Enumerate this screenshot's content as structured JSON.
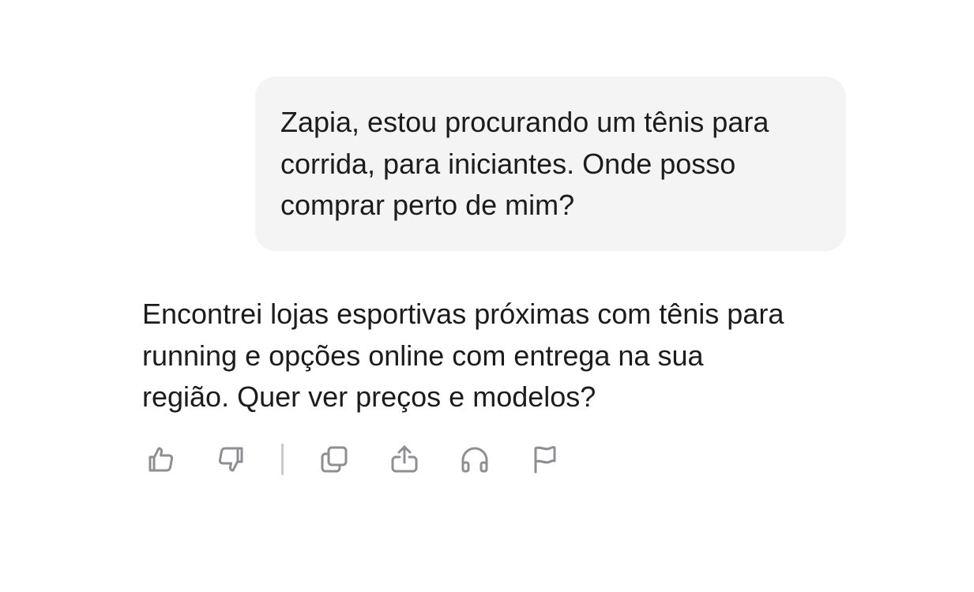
{
  "conversation": {
    "user_message": "Zapia, estou procurando um tênis para\ncorrida, para iniciantes. Onde posso\ncomprar perto de mim?",
    "assistant_message": "Encontrei lojas esportivas próximas com tênis para\nrunning e opções online com entrega na sua\nregião. Quer ver preços e modelos?"
  },
  "actions": [
    {
      "name": "like",
      "icon": "thumbs-up-icon"
    },
    {
      "name": "dislike",
      "icon": "thumbs-down-icon"
    },
    {
      "name": "copy",
      "icon": "copy-icon"
    },
    {
      "name": "share",
      "icon": "share-icon"
    },
    {
      "name": "listen",
      "icon": "headphones-icon"
    },
    {
      "name": "report",
      "icon": "flag-icon"
    }
  ],
  "colors": {
    "bubble_bg": "#f4f4f4",
    "text": "#1c1c1c",
    "icon": "#8e8e93",
    "divider": "#c9c9c9"
  }
}
